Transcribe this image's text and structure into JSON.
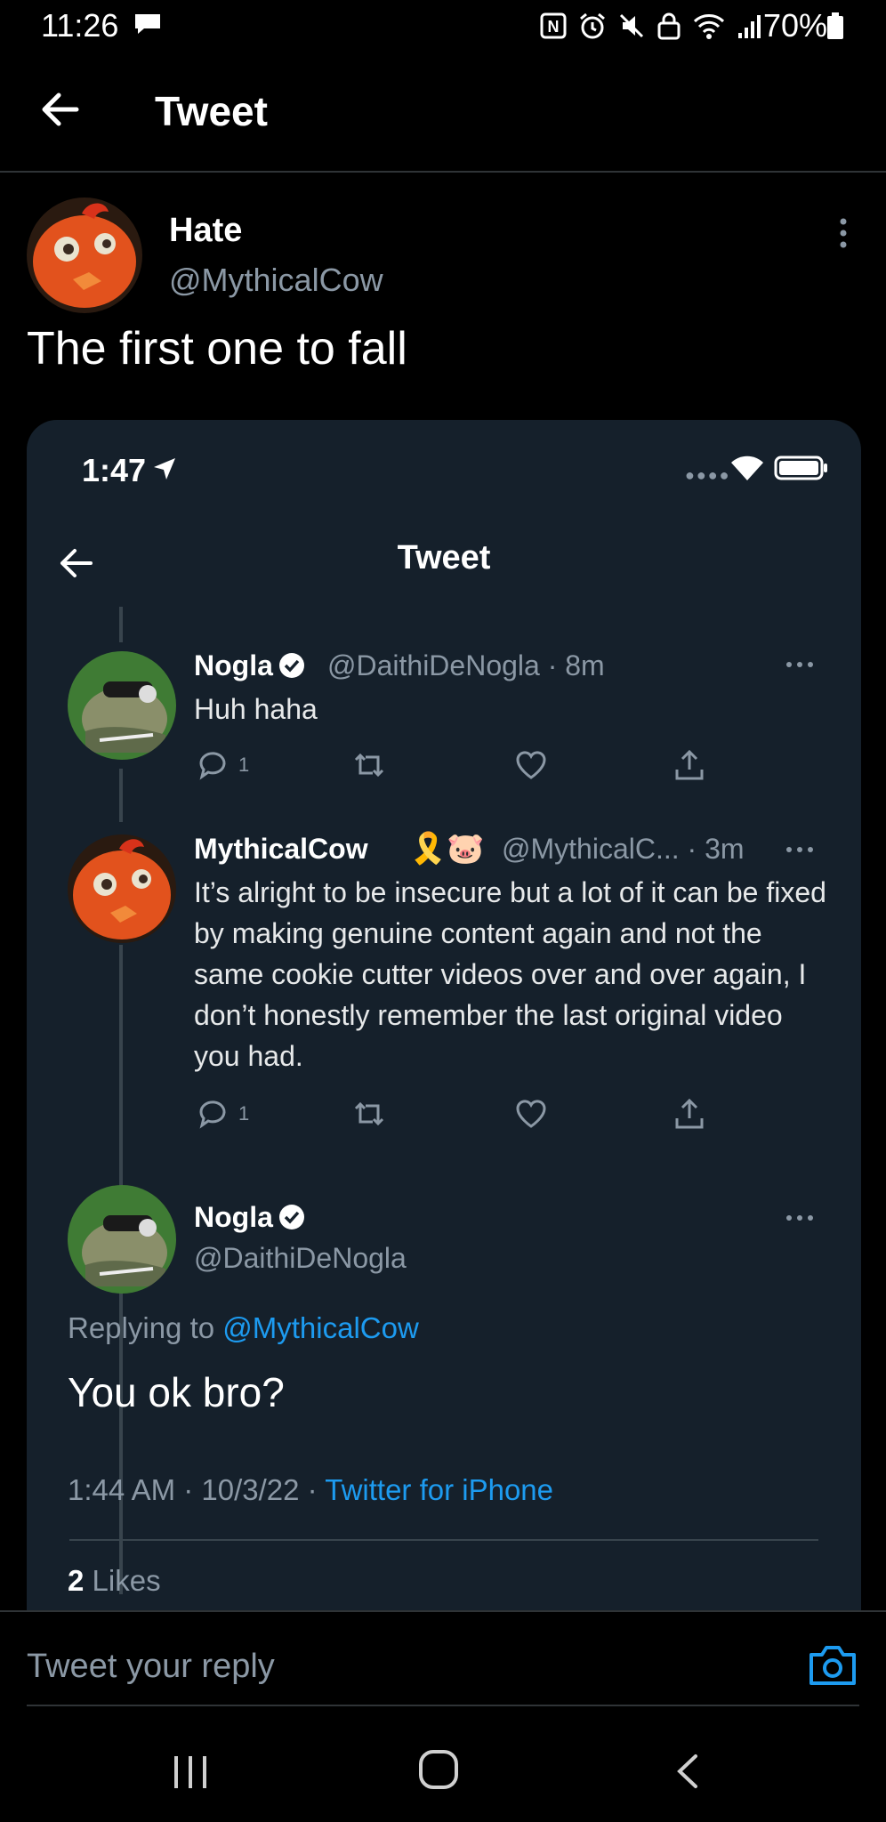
{
  "status_bar": {
    "time": "11:26",
    "battery": "70%",
    "icons": [
      "message-icon",
      "nfc-icon",
      "alarm-icon",
      "mute-icon",
      "lock-icon",
      "wifi-icon",
      "signal-icon",
      "battery-icon"
    ]
  },
  "header": {
    "title": "Tweet"
  },
  "tweet": {
    "author_name": "Hate",
    "author_handle": "@MythicalCow",
    "text": "The first one to fall"
  },
  "screenshot": {
    "status_time": "1:47",
    "title": "Tweet",
    "thread": [
      {
        "name": "Nogla",
        "handle_time": "@DaithiDeNogla · 8m",
        "text": "Huh haha",
        "reply_count": "1",
        "like_count": ""
      },
      {
        "name": "MythicalCow",
        "emojis": "🎗️🐷",
        "handle_time": "@MythicalC... · 3m",
        "text": "It’s alright to be insecure but a lot of it can be fixed by making genuine content again and not the same cookie cutter videos over and over again, I don’t honestly remember the last original video you had.",
        "reply_count": "1"
      }
    ],
    "focused": {
      "name": "Nogla",
      "handle": "@DaithiDeNogla",
      "replying_prefix": "Replying to ",
      "replying_handle": "@MythicalCow",
      "text": "You ok bro?",
      "timestamp": "1:44 AM · 10/3/22 · ",
      "source": "Twitter for iPhone",
      "likes_count": "2",
      "likes_label": " Likes"
    }
  },
  "reply": {
    "placeholder": "Tweet your reply"
  },
  "colors": {
    "accent": "#1d9bf0",
    "card_bg": "#15202b",
    "muted": "#8b98a5"
  }
}
